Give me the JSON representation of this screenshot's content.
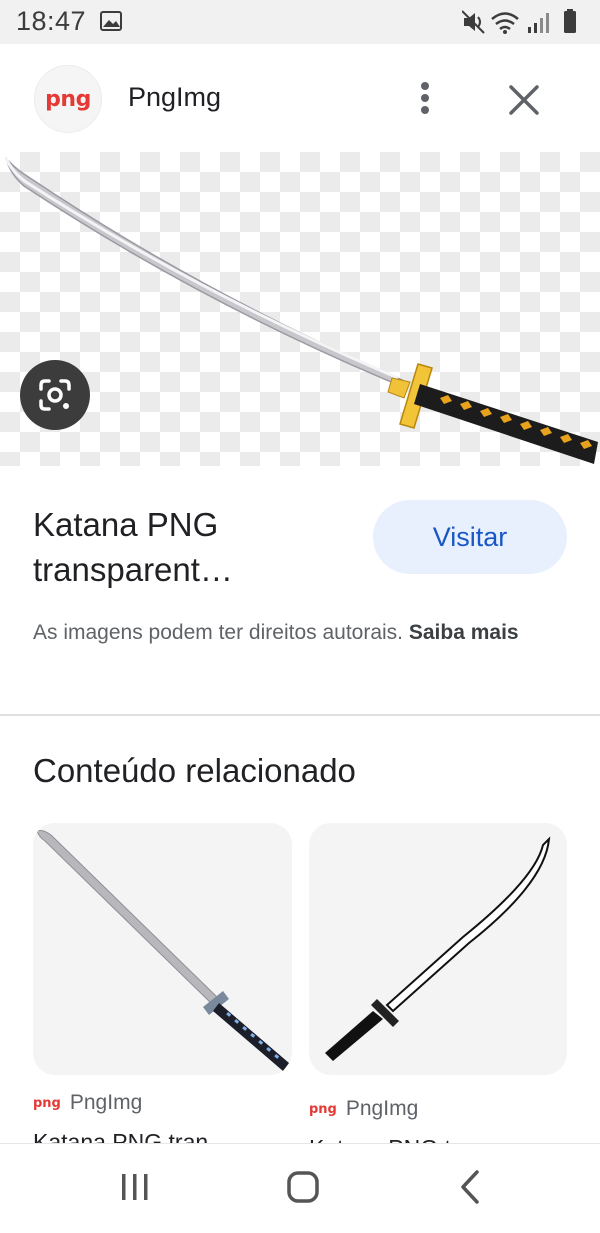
{
  "status_bar": {
    "time": "18:47",
    "icons": [
      "gallery-icon",
      "mute-icon",
      "wifi-icon",
      "signal-icon",
      "battery-icon"
    ]
  },
  "header": {
    "logo_text": "png",
    "site_name": "PngImg",
    "more_icon": "more-vert-icon",
    "close_icon": "close-icon"
  },
  "result": {
    "title": "Katana PNG transparent…",
    "visit_label": "Visitar",
    "copyright_text": "As imagens podem ter direitos autorais.",
    "learn_more": "Saiba mais"
  },
  "related": {
    "heading": "Conteúdo relacionado",
    "items": [
      {
        "source_logo": "png",
        "source": "PngImg",
        "caption": "Katana PNG tran"
      },
      {
        "source_logo": "png",
        "source": "PngImg",
        "caption": "Katana PNG t"
      }
    ]
  },
  "nav": {
    "icons": [
      "recent-apps-icon",
      "home-icon",
      "back-icon"
    ]
  },
  "colors": {
    "accent_blue": "#1a57c6",
    "visit_bg": "#e8f0fe",
    "brand_red": "#e53935"
  }
}
